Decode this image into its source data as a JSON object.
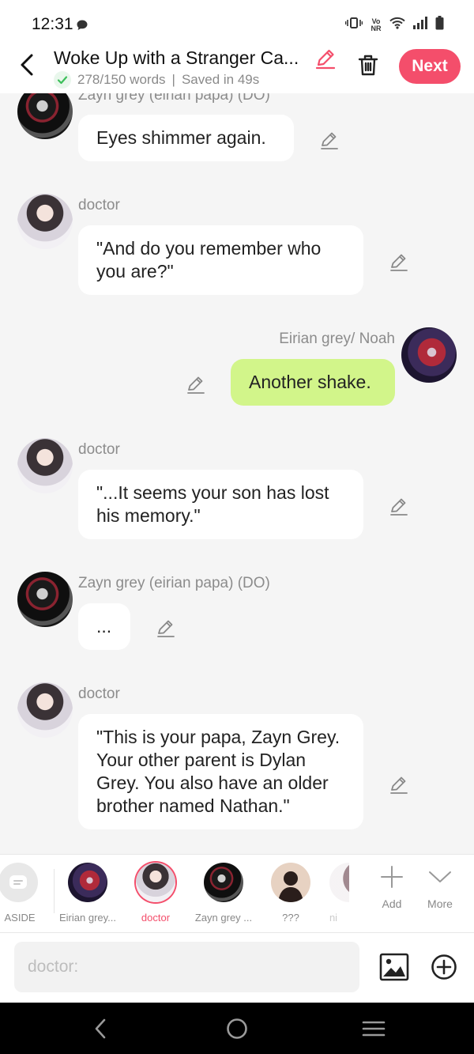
{
  "status_bar": {
    "time": "12:31",
    "network_label": "Vo NR"
  },
  "header": {
    "title": "Woke Up with a Stranger Ca...",
    "word_count": "278/150 words",
    "separator": "|",
    "saved_status": "Saved in 49s",
    "next_label": "Next"
  },
  "messages": [
    {
      "speaker": "Zayn grey (eirian papa) (DO)",
      "text": "Eyes shimmer again."
    },
    {
      "speaker": "doctor",
      "text": "\"And do you remember who you are?\""
    },
    {
      "speaker": "Eirian grey/ Noah",
      "text": "Another shake."
    },
    {
      "speaker": "doctor",
      "text": "\"...It seems your son has lost his memory.\""
    },
    {
      "speaker": "Zayn grey (eirian papa) (DO)",
      "text": "..."
    },
    {
      "speaker": "doctor",
      "text": "\"This is your papa, Zayn Grey. Your other parent is Dylan Grey. You also have an older brother named Nathan.\""
    }
  ],
  "character_bar": {
    "aside_label": "ASIDE",
    "characters": [
      {
        "name": "Eirian grey..."
      },
      {
        "name": "doctor"
      },
      {
        "name": "Zayn grey ..."
      },
      {
        "name": "???"
      },
      {
        "name": "ni"
      }
    ],
    "add_label": "Add",
    "more_label": "More"
  },
  "input": {
    "placeholder": "doctor:"
  },
  "colors": {
    "accent": "#f44e6b",
    "self_bubble": "#d2f58a",
    "check": "#3cbf5a"
  }
}
